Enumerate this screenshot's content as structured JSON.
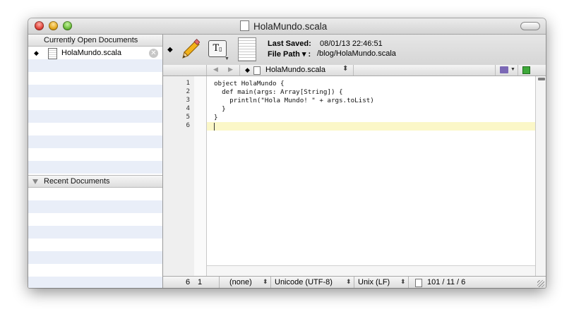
{
  "window": {
    "title": "HolaMundo.scala"
  },
  "sidebar": {
    "open_header": "Currently Open Documents",
    "open_docs": [
      {
        "bullet": "◆",
        "name": "HolaMundo.scala"
      }
    ],
    "recent_header": "Recent Documents",
    "bottom": {
      "add": "+",
      "gear": "⚙▾"
    }
  },
  "toolbar": {
    "bullet": "◆",
    "font_button": "T",
    "last_saved_label": "Last Saved:",
    "last_saved_value": "08/01/13 22:46:51",
    "file_path_label": "File Path ▾ :",
    "file_path_value": "/blog/HolaMundo.scala"
  },
  "navbar": {
    "back": "◀",
    "forward": "▶",
    "bullet": "◆",
    "file_name": "HolaMundo.scala",
    "updown": "⬍"
  },
  "editor": {
    "line_numbers": [
      "1",
      "2",
      "3",
      "4",
      "5",
      "6"
    ],
    "lines": [
      "object HolaMundo {",
      "  def main(args: Array[String]) {",
      "    println(\"Hola Mundo! \" + args.toList)",
      "  }",
      "}",
      ""
    ],
    "current_line_color": "#fbf7c8"
  },
  "statusbar": {
    "line": "6",
    "column": "1",
    "syntax": "(none)",
    "encoding": "Unicode (UTF-8)",
    "line_endings": "Unix (LF)",
    "counts": "101 / 11 / 6"
  }
}
